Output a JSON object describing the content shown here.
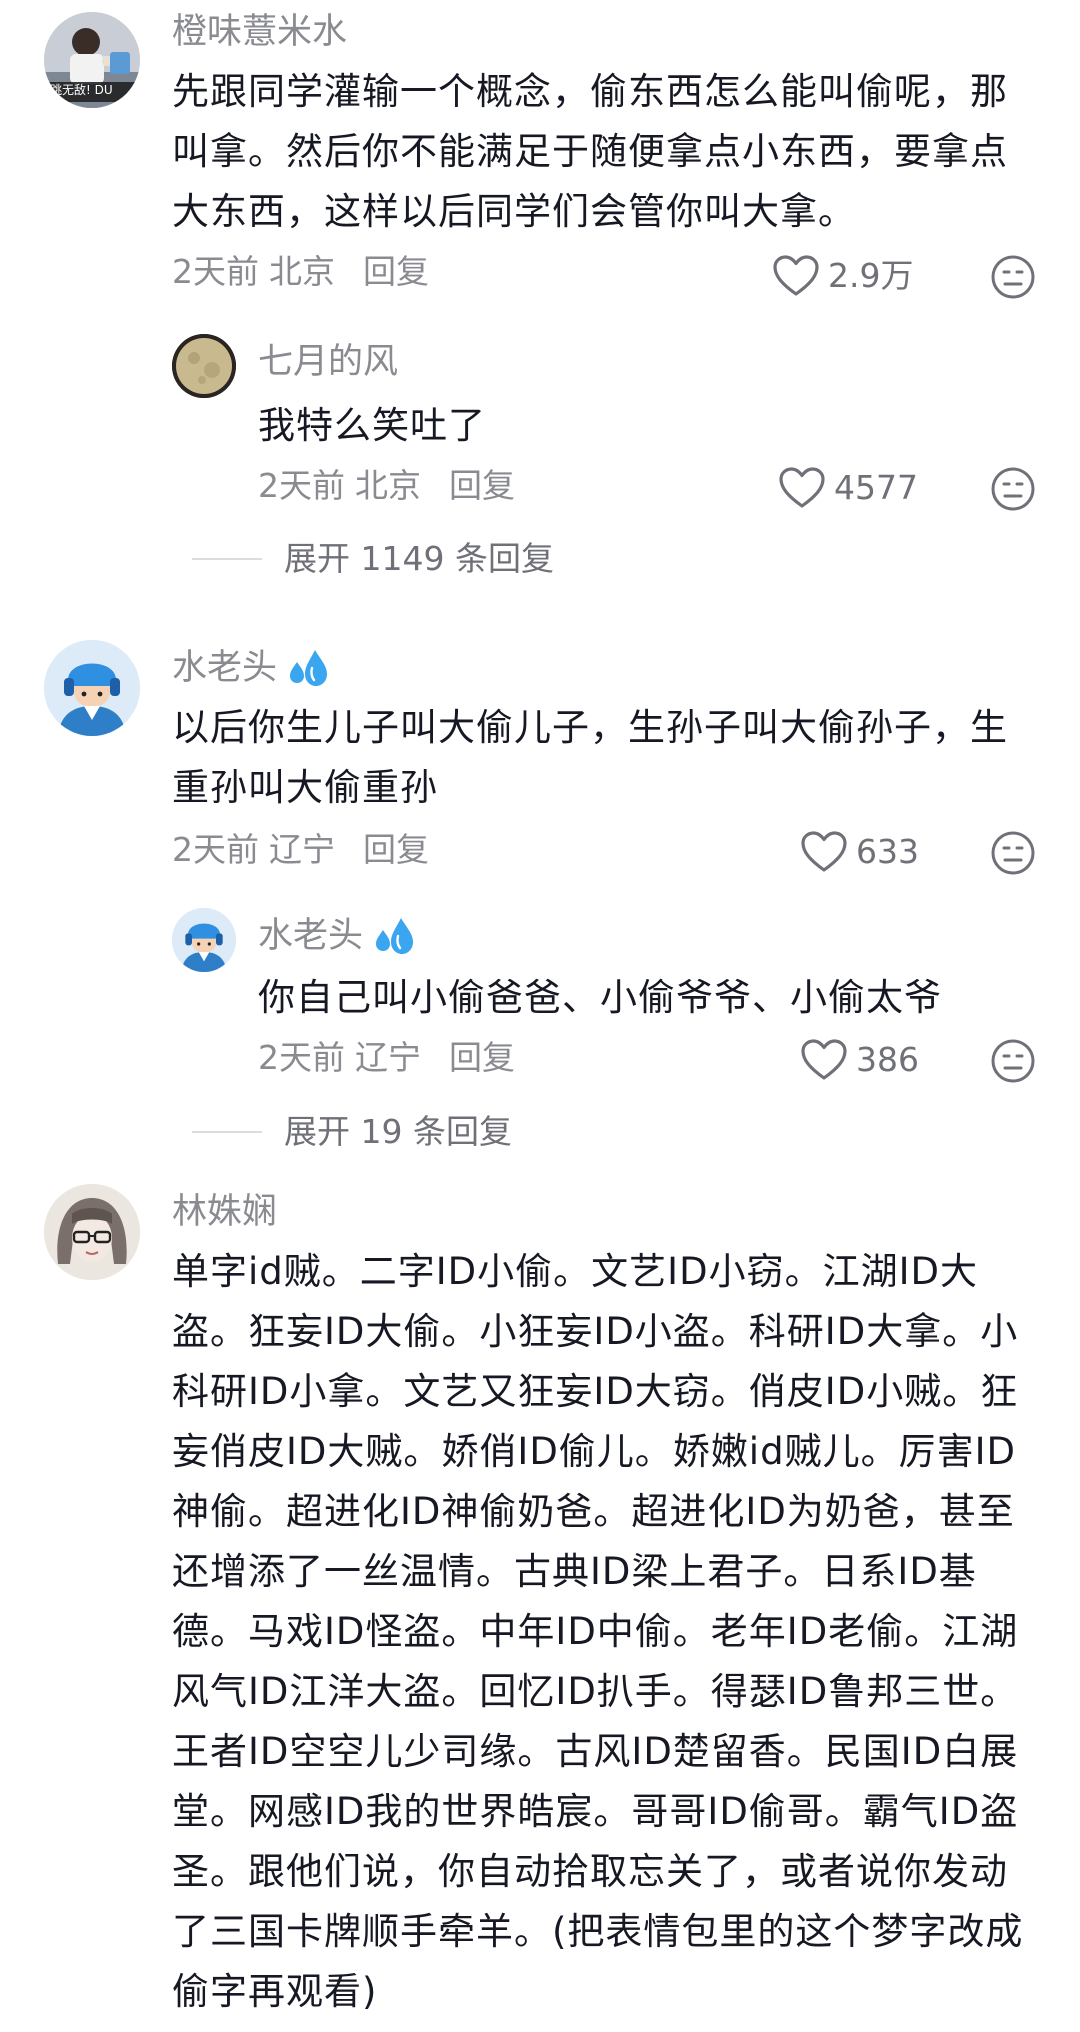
{
  "comments": [
    {
      "username": "橙味薏米水",
      "avatar_icon": "person-photo-avatar",
      "text": "先跟同学灌输一个概念，偷东西怎么能叫偷呢，那叫拿。然后你不能满足于随便拿点小东西，要拿点大东西，这样以后同学们会管你叫大拿。",
      "time": "2天前",
      "location": "北京",
      "reply_label": "回复",
      "likes": "2.9万",
      "avatar_caption": "跳无敌! DU",
      "replies": [
        {
          "username": "七月的风",
          "avatar_icon": "moon-avatar",
          "text": "我特么笑吐了",
          "time": "2天前",
          "location": "北京",
          "reply_label": "回复",
          "likes": "4577"
        }
      ],
      "expand_label": "展开 1149 条回复"
    },
    {
      "username": "水老头",
      "avatar_icon": "cartoon-helmet-avatar",
      "badge_icon": "water-drops-icon",
      "text": "以后你生儿子叫大偷儿子，生孙子叫大偷孙子，生重孙叫大偷重孙",
      "time": "2天前",
      "location": "辽宁",
      "reply_label": "回复",
      "likes": "633",
      "replies": [
        {
          "username": "水老头",
          "avatar_icon": "cartoon-helmet-avatar",
          "badge_icon": "water-drops-icon",
          "text": "你自己叫小偷爸爸、小偷爷爷、小偷太爷",
          "time": "2天前",
          "location": "辽宁",
          "reply_label": "回复",
          "likes": "386"
        }
      ],
      "expand_label": "展开 19 条回复"
    },
    {
      "username": "林姝娴",
      "avatar_icon": "anime-girl-avatar",
      "text": "单字id贼。二字ID小偷。文艺ID小窃。江湖ID大盗。狂妄ID大偷。小狂妄ID小盗。科研ID大拿。小科研ID小拿。文艺又狂妄ID大窃。俏皮ID小贼。狂妄俏皮ID大贼。娇俏ID偷儿。娇嫩id贼儿。厉害ID神偷。超进化ID神偷奶爸。超进化ID为奶爸，甚至还增添了一丝温情。古典ID梁上君子。日系ID基德。马戏ID怪盗。中年ID中偷。老年ID老偷。江湖风气ID江洋大盗。回忆ID扒手。得瑟ID鲁邦三世。王者ID空空儿少司缘。古风ID楚留香。民国ID白展堂。网感ID我的世界皓宸。哥哥ID偷哥。霸气ID盗圣。跟他们说，你自动拾取忘关了，或者说你发动了三国卡牌顺手牵羊。(把表情包里的这个梦字改成偷字再观看)"
    }
  ],
  "colors": {
    "text_primary": "#161823",
    "text_secondary": "#8a8b91",
    "icon_gray": "#6f7078"
  }
}
